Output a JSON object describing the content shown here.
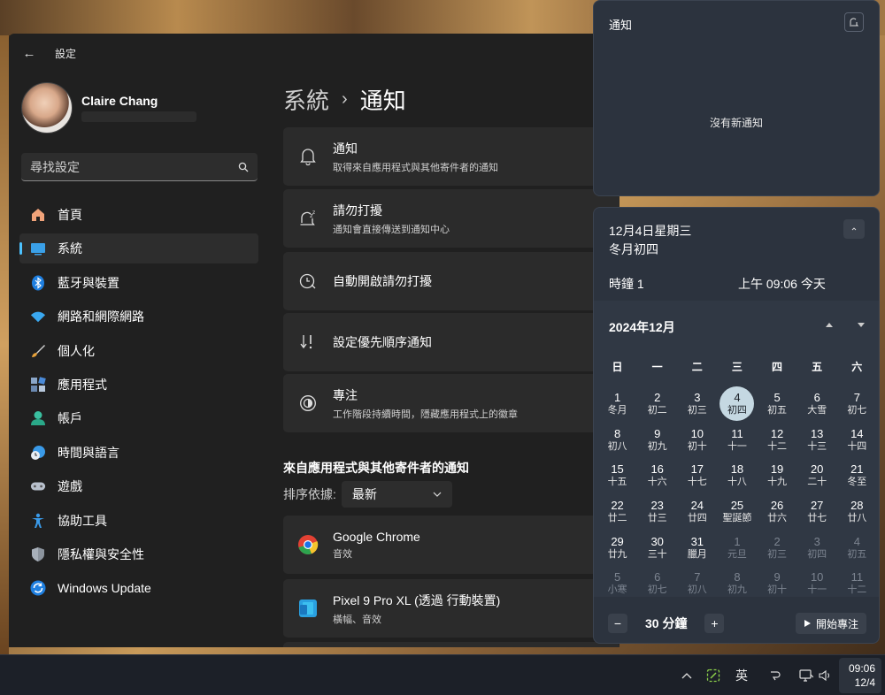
{
  "settings": {
    "window_title": "設定",
    "user": {
      "name": "Claire Chang"
    },
    "search_placeholder": "尋找設定",
    "nav": [
      {
        "label": "首頁",
        "icon": "home-icon"
      },
      {
        "label": "系統",
        "icon": "system-icon",
        "active": true
      },
      {
        "label": "藍牙與裝置",
        "icon": "bluetooth-icon"
      },
      {
        "label": "網路和網際網路",
        "icon": "wifi-icon"
      },
      {
        "label": "個人化",
        "icon": "brush-icon"
      },
      {
        "label": "應用程式",
        "icon": "apps-icon"
      },
      {
        "label": "帳戶",
        "icon": "account-icon"
      },
      {
        "label": "時間與語言",
        "icon": "globe-clock-icon"
      },
      {
        "label": "遊戲",
        "icon": "gamepad-icon"
      },
      {
        "label": "協助工具",
        "icon": "accessibility-icon"
      },
      {
        "label": "隱私權與安全性",
        "icon": "shield-icon"
      },
      {
        "label": "Windows Update",
        "icon": "update-icon"
      }
    ],
    "breadcrumb": {
      "parent": "系統",
      "separator": "›",
      "current": "通知"
    },
    "cards": [
      {
        "title": "通知",
        "subtitle": "取得來自應用程式與其他寄件者的通知",
        "icon": "bell-icon"
      },
      {
        "title": "請勿打擾",
        "subtitle": "通知會直接傳送到通知中心",
        "icon": "bell-snooze-icon"
      },
      {
        "title": "自動開啟請勿打擾",
        "subtitle": "",
        "icon": "clock-icon"
      },
      {
        "title": "設定優先順序通知",
        "subtitle": "",
        "icon": "priority-icon"
      },
      {
        "title": "專注",
        "subtitle": "工作階段持續時間，隱藏應用程式上的徽章",
        "icon": "focus-icon"
      }
    ],
    "apps_section_title": "來自應用程式與其他寄件者的通知",
    "sort_label": "排序依據:",
    "sort_value": "最新",
    "apps": [
      {
        "name": "Google Chrome",
        "subtitle": "音效",
        "icon": "chrome-icon"
      },
      {
        "name": "Pixel 9 Pro XL (透過 行動裝置)",
        "subtitle": "橫幅、音效",
        "icon": "phone-link-icon"
      }
    ]
  },
  "notifications": {
    "title": "通知",
    "empty_text": "沒有新通知"
  },
  "calendar": {
    "date_line": "12月4日星期三",
    "lunar_line": "冬月初四",
    "clock_name": "時鐘 1",
    "clock_time": "上午 09:06 今天",
    "month_label": "2024年12月",
    "weekdays": [
      "日",
      "一",
      "二",
      "三",
      "四",
      "五",
      "六"
    ],
    "days": [
      {
        "n": "1",
        "l": "冬月"
      },
      {
        "n": "2",
        "l": "初二"
      },
      {
        "n": "3",
        "l": "初三"
      },
      {
        "n": "4",
        "l": "初四",
        "today": true
      },
      {
        "n": "5",
        "l": "初五"
      },
      {
        "n": "6",
        "l": "大雪"
      },
      {
        "n": "7",
        "l": "初七"
      },
      {
        "n": "8",
        "l": "初八"
      },
      {
        "n": "9",
        "l": "初九"
      },
      {
        "n": "10",
        "l": "初十"
      },
      {
        "n": "11",
        "l": "十一"
      },
      {
        "n": "12",
        "l": "十二"
      },
      {
        "n": "13",
        "l": "十三"
      },
      {
        "n": "14",
        "l": "十四"
      },
      {
        "n": "15",
        "l": "十五"
      },
      {
        "n": "16",
        "l": "十六"
      },
      {
        "n": "17",
        "l": "十七"
      },
      {
        "n": "18",
        "l": "十八"
      },
      {
        "n": "19",
        "l": "十九"
      },
      {
        "n": "20",
        "l": "二十"
      },
      {
        "n": "21",
        "l": "冬至"
      },
      {
        "n": "22",
        "l": "廿二"
      },
      {
        "n": "23",
        "l": "廿三"
      },
      {
        "n": "24",
        "l": "廿四"
      },
      {
        "n": "25",
        "l": "聖誕節"
      },
      {
        "n": "26",
        "l": "廿六"
      },
      {
        "n": "27",
        "l": "廿七"
      },
      {
        "n": "28",
        "l": "廿八"
      },
      {
        "n": "29",
        "l": "廿九"
      },
      {
        "n": "30",
        "l": "三十"
      },
      {
        "n": "31",
        "l": "臘月"
      },
      {
        "n": "1",
        "l": "元旦",
        "muted": true
      },
      {
        "n": "2",
        "l": "初三",
        "muted": true
      },
      {
        "n": "3",
        "l": "初四",
        "muted": true
      },
      {
        "n": "4",
        "l": "初五",
        "muted": true
      },
      {
        "n": "5",
        "l": "小寒",
        "muted": true
      },
      {
        "n": "6",
        "l": "初七",
        "muted": true
      },
      {
        "n": "7",
        "l": "初八",
        "muted": true
      },
      {
        "n": "8",
        "l": "初九",
        "muted": true
      },
      {
        "n": "9",
        "l": "初十",
        "muted": true
      },
      {
        "n": "10",
        "l": "十一",
        "muted": true
      },
      {
        "n": "11",
        "l": "十二",
        "muted": true
      }
    ],
    "focus_minutes": "30 分鐘",
    "start_focus_label": "開始專注"
  },
  "taskbar": {
    "ime_label": "英",
    "time": "09:06",
    "date": "12/4"
  }
}
